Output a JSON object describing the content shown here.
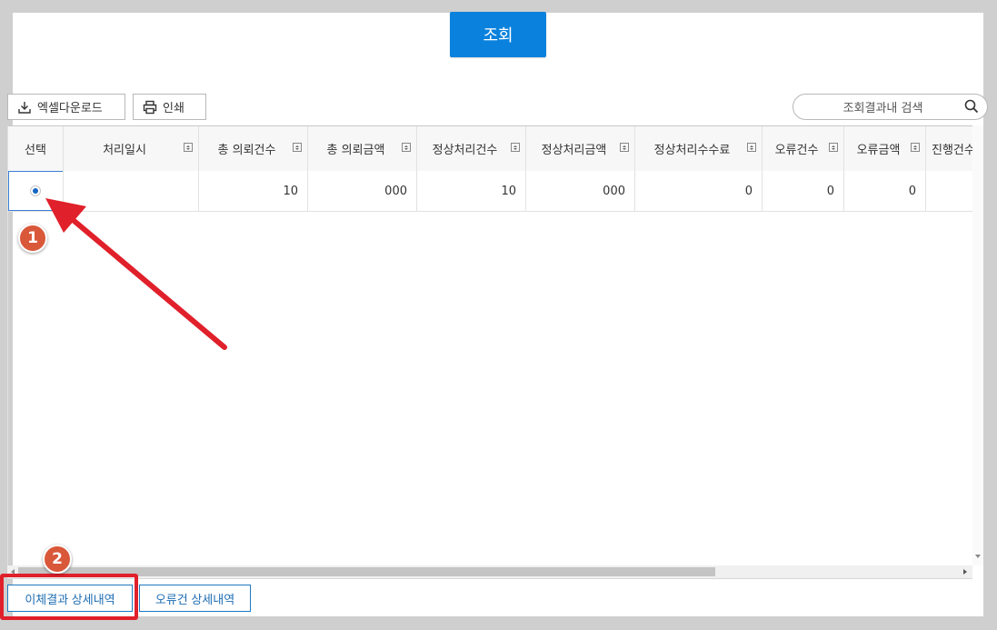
{
  "search_button": {
    "label": "조회"
  },
  "toolbar": {
    "excel_label": "엑셀다운로드",
    "print_label": "인쇄",
    "search_placeholder": "조회결과내 검색"
  },
  "grid": {
    "headers": [
      "선택",
      "처리일시",
      "총 의뢰건수",
      "총 의뢰금액",
      "정상처리건수",
      "정상처리금액",
      "정상처리수수료",
      "오류건수",
      "오류금액",
      "진행건수"
    ],
    "row": [
      "",
      "",
      "10",
      "000",
      "10",
      "000",
      "0",
      "0",
      "0",
      ""
    ]
  },
  "bottom": {
    "transfer_detail_label": "이체결과 상세내역",
    "error_detail_label": "오류건 상세내역"
  },
  "annotations": {
    "badge1": "1",
    "badge2": "2"
  },
  "colors": {
    "primary": "#0a82dd",
    "annotation_red": "#e0202a",
    "badge": "#d9583a"
  }
}
